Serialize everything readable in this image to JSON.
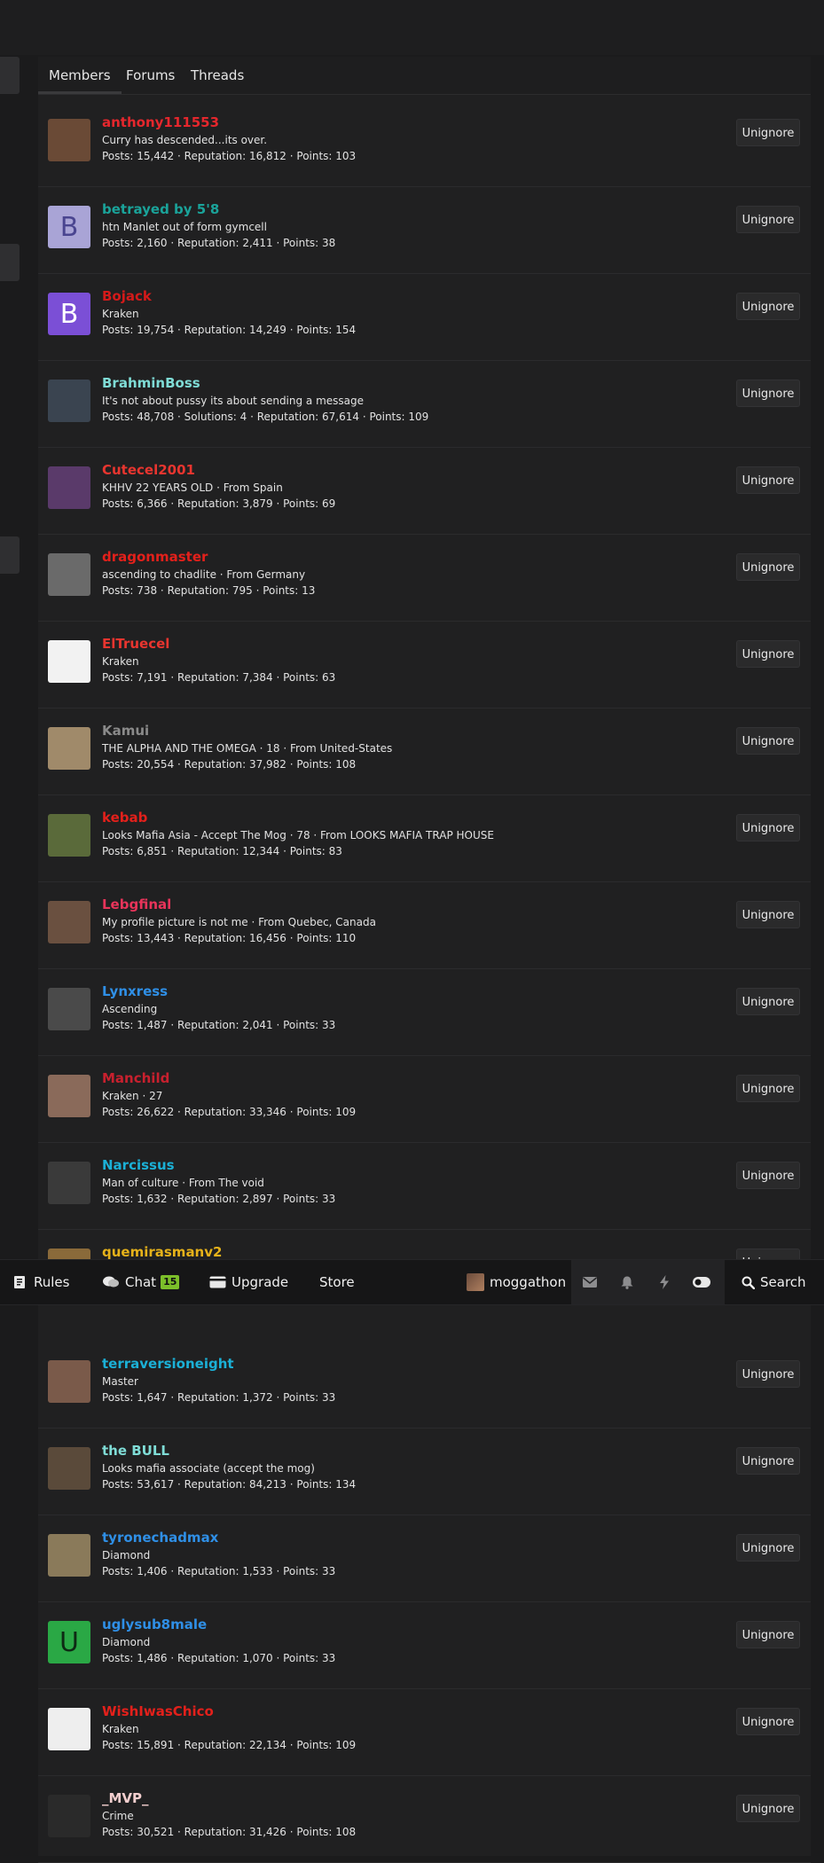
{
  "tabs": [
    "Members",
    "Forums",
    "Threads"
  ],
  "unignore_label": "Unignore",
  "members": [
    {
      "name": "anthony111553",
      "color": "#e5272d",
      "title": "Curry has descended...its over.",
      "stats": "Posts: 15,442 · Reputation: 16,812 · Points: 103",
      "avatar_bg": "#6a4a36"
    },
    {
      "name": "betrayed by 5'8",
      "color": "#1aa39a",
      "title": "htn Manlet out of form gymcell",
      "stats": "Posts: 2,160 · Reputation: 2,411 · Points: 38",
      "avatar_letter": "B",
      "avatar_bg": "#a9a4d6",
      "avatar_fg": "#4a4590"
    },
    {
      "name": "Bojack",
      "color": "#d41a1a",
      "title": "Kraken",
      "stats": "Posts: 19,754 · Reputation: 14,249 · Points: 154",
      "avatar_letter": "B",
      "avatar_bg": "#7b4fd6",
      "avatar_fg": "#ffffff"
    },
    {
      "name": "BrahminBoss",
      "color": "#7fdcd6",
      "title": "It's not about pussy its about sending a message",
      "stats": "Posts: 48,708 · Solutions: 4 · Reputation: 67,614 · Points: 109",
      "avatar_bg": "#3a4450"
    },
    {
      "name": "Cutecel2001",
      "color": "#e8352f",
      "title": "KHHV 22 YEARS OLD · From Spain",
      "stats": "Posts: 6,366 · Reputation: 3,879 · Points: 69",
      "avatar_bg": "#5a3a6a"
    },
    {
      "name": "dragonmaster",
      "color": "#e3201b",
      "title": "ascending to chadlite · From Germany",
      "stats": "Posts: 738 · Reputation: 795 · Points: 13",
      "avatar_bg": "#6a6a6a"
    },
    {
      "name": "ElTruecel",
      "color": "#e8352f",
      "title": "Kraken",
      "stats": "Posts: 7,191 · Reputation: 7,384 · Points: 63",
      "avatar_bg": "#f2f2f2"
    },
    {
      "name": "Kamui",
      "color": "#8a8a8a",
      "title": "THE ALPHA AND THE OMEGA · 18 · From United-States",
      "stats": "Posts: 20,554 · Reputation: 37,982 · Points: 108",
      "avatar_bg": "#a08a6a"
    },
    {
      "name": "kebab",
      "color": "#e3201b",
      "title": "Looks Mafia Asia - Accept The Mog · 78 · From LOOKS MAFIA TRAP HOUSE",
      "stats": "Posts: 6,851 · Reputation: 12,344 · Points: 83",
      "avatar_bg": "#5a6a3a"
    },
    {
      "name": "Lebgfinal",
      "color": "#e8345a",
      "title": "My profile picture is not me · From Quebec, Canada",
      "stats": "Posts: 13,443 · Reputation: 16,456 · Points: 110",
      "avatar_bg": "#6a5040"
    },
    {
      "name": "Lynxress",
      "color": "#2f8fe6",
      "title": "Ascending",
      "stats": "Posts: 1,487 · Reputation: 2,041 · Points: 33",
      "avatar_bg": "#4a4a4a"
    },
    {
      "name": "Manchild",
      "color": "#c8202e",
      "title": "Kraken · 27",
      "stats": "Posts: 26,622 · Reputation: 33,346 · Points: 109",
      "avatar_bg": "#8a6a5a"
    },
    {
      "name": "Narcissus",
      "color": "#1bb0d6",
      "title": "Man of culture · From The void",
      "stats": "Posts: 1,632 · Reputation: 2,897 · Points: 33",
      "avatar_bg": "#3a3a3a"
    },
    {
      "name": "quemirasmanv2",
      "color": "#e6b21a",
      "title": "",
      "stats": "",
      "avatar_bg": "#8a6a3a"
    },
    {
      "name": "terraversioneight",
      "color": "#1bb0d6",
      "title": "Master",
      "stats": "Posts: 1,647 · Reputation: 1,372 · Points: 33",
      "avatar_bg": "#7a5a4a"
    },
    {
      "name": "the BULL",
      "color": "#7fdcd6",
      "title": "Looks mafia associate (accept the mog)",
      "stats": "Posts: 53,617 · Reputation: 84,213 · Points: 134",
      "avatar_bg": "#5a4a3a"
    },
    {
      "name": "tyronechadmax",
      "color": "#2f8fe6",
      "title": "Diamond",
      "stats": "Posts: 1,406 · Reputation: 1,533 · Points: 33",
      "avatar_bg": "#8a7a5a"
    },
    {
      "name": "uglysub8male",
      "color": "#2f8fe6",
      "title": "Diamond",
      "stats": "Posts: 1,486 · Reputation: 1,070 · Points: 33",
      "avatar_letter": "U",
      "avatar_bg": "#2aa845",
      "avatar_fg": "#0e2a14"
    },
    {
      "name": "WishIwasChico",
      "color": "#e3201b",
      "title": "Kraken",
      "stats": "Posts: 15,891 · Reputation: 22,134 · Points: 109",
      "avatar_bg": "#eeeeee"
    },
    {
      "name": "_MVP_",
      "color": "#f4cfcf",
      "title": "Crime",
      "stats": "Posts: 30,521 · Reputation: 31,426 · Points: 108",
      "avatar_bg": "#2a2a2a"
    }
  ],
  "nav": {
    "rules": "Rules",
    "chat": "Chat",
    "chat_count": "15",
    "upgrade": "Upgrade",
    "store": "Store",
    "username": "moggathon",
    "search": "Search"
  }
}
